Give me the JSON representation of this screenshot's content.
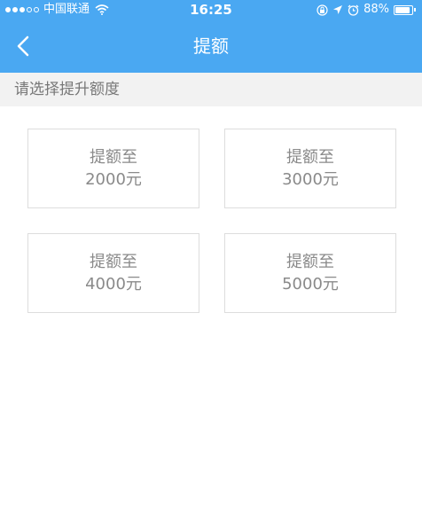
{
  "status_bar": {
    "carrier": "中国联通",
    "time": "16:25",
    "battery": "88%",
    "battery_level": 0.88
  },
  "nav": {
    "title": "提额"
  },
  "hint": {
    "text": "请选择提升额度"
  },
  "options": [
    {
      "label": "提额至",
      "amount": "2000元"
    },
    {
      "label": "提额至",
      "amount": "3000元"
    },
    {
      "label": "提额至",
      "amount": "4000元"
    },
    {
      "label": "提额至",
      "amount": "5000元"
    }
  ],
  "colors": {
    "accent": "#4aa8f2",
    "hint_bg": "#f2f2f2",
    "card_border": "#dddddd",
    "card_text": "#8a8a8a"
  }
}
